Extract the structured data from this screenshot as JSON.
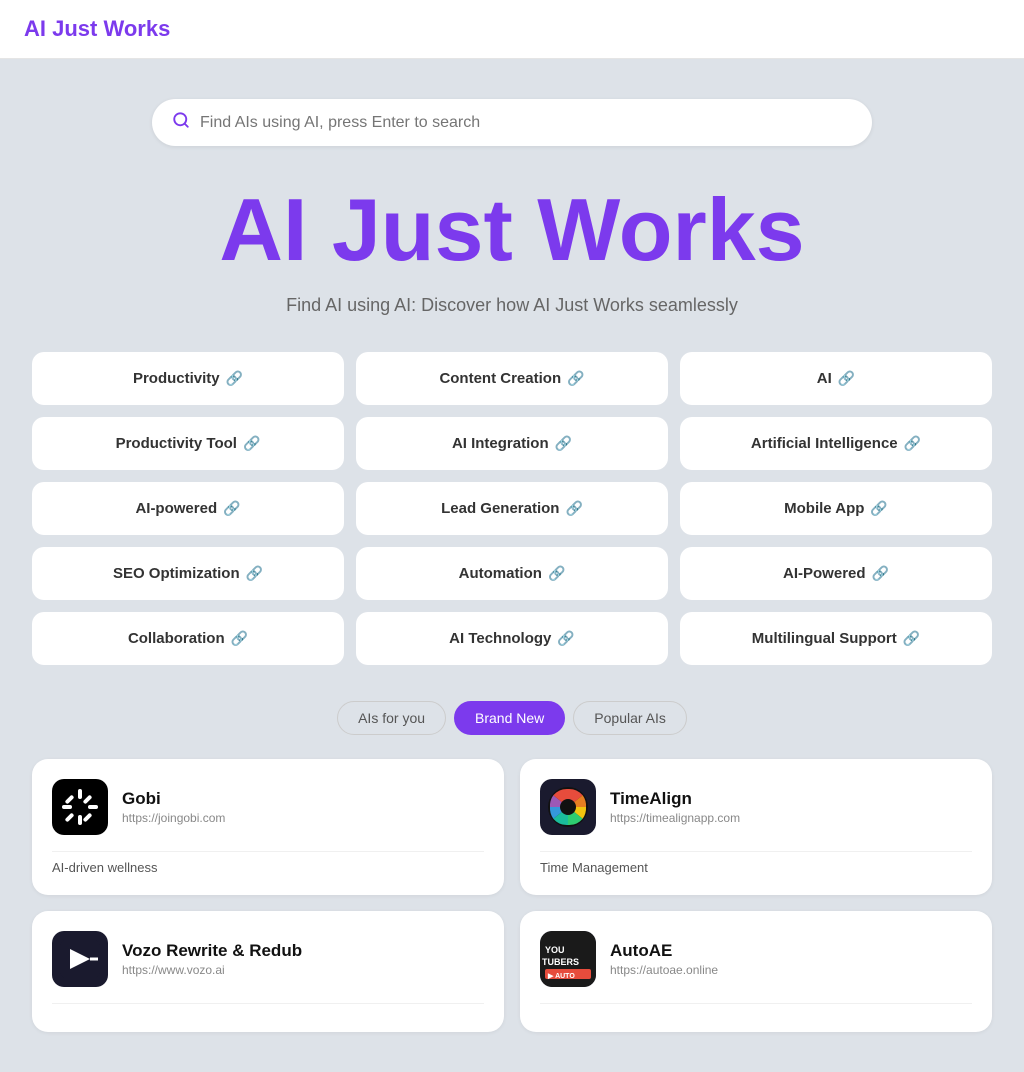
{
  "header": {
    "logo": "AI Just Works",
    "logo_href": "#"
  },
  "search": {
    "placeholder": "Find AIs using AI, press Enter to search"
  },
  "hero": {
    "title": "AI Just Works",
    "subtitle": "Find AI using AI: Discover how AI Just Works seamlessly"
  },
  "categories": [
    {
      "label": "Productivity",
      "id": "productivity"
    },
    {
      "label": "Content Creation",
      "id": "content-creation"
    },
    {
      "label": "AI",
      "id": "ai"
    },
    {
      "label": "Productivity Tool",
      "id": "productivity-tool"
    },
    {
      "label": "AI Integration",
      "id": "ai-integration"
    },
    {
      "label": "Artificial Intelligence",
      "id": "artificial-intelligence"
    },
    {
      "label": "AI-powered",
      "id": "ai-powered"
    },
    {
      "label": "Lead Generation",
      "id": "lead-generation"
    },
    {
      "label": "Mobile App",
      "id": "mobile-app"
    },
    {
      "label": "SEO Optimization",
      "id": "seo-optimization"
    },
    {
      "label": "Automation",
      "id": "automation"
    },
    {
      "label": "AI-Powered",
      "id": "ai-powered-2"
    },
    {
      "label": "Collaboration",
      "id": "collaboration"
    },
    {
      "label": "AI Technology",
      "id": "ai-technology"
    },
    {
      "label": "Multilingual Support",
      "id": "multilingual-support"
    }
  ],
  "tabs": [
    {
      "label": "AIs for you",
      "id": "for-you",
      "active": false
    },
    {
      "label": "Brand New",
      "id": "brand-new",
      "active": true
    },
    {
      "label": "Popular AIs",
      "id": "popular",
      "active": false
    }
  ],
  "ai_cards": [
    {
      "id": "gobi",
      "name": "Gobi",
      "url": "https://joingobi.com",
      "tag": "AI-driven wellness",
      "logo_type": "gobi"
    },
    {
      "id": "timealign",
      "name": "TimeAlign",
      "url": "https://timealignapp.com",
      "tag": "Time Management",
      "logo_type": "timealign"
    },
    {
      "id": "vozo",
      "name": "Vozo Rewrite & Redub",
      "url": "https://www.vozo.ai",
      "tag": "",
      "logo_type": "vozo"
    },
    {
      "id": "autoae",
      "name": "AutoAE",
      "url": "https://autoae.online",
      "tag": "",
      "logo_type": "autoae"
    }
  ]
}
